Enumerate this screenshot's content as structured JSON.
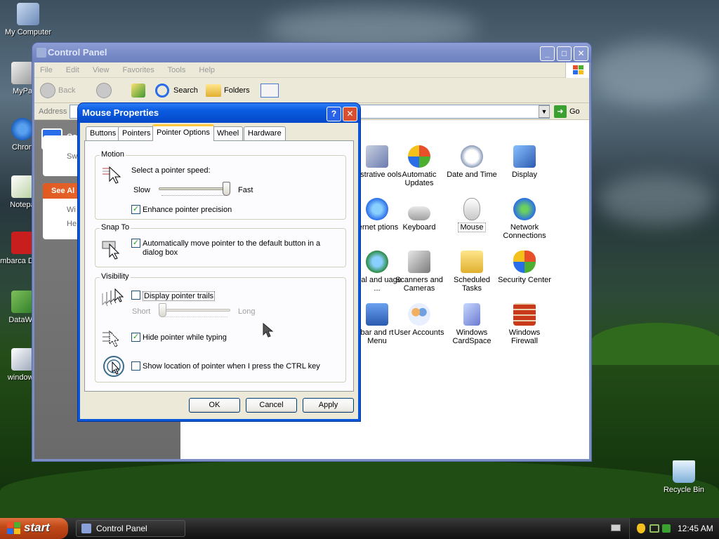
{
  "desktop": {
    "icons": [
      {
        "label": "My Computer"
      },
      {
        "label": "MyPa"
      },
      {
        "label": "Chron"
      },
      {
        "label": "Notepa"
      },
      {
        "label": "Embarca Dev-C"
      },
      {
        "label": "DataWa"
      },
      {
        "label": "windows"
      }
    ],
    "recycle_bin": "Recycle Bin"
  },
  "control_panel": {
    "title": "Control Panel",
    "menu": [
      "File",
      "Edit",
      "View",
      "Favorites",
      "Tools",
      "Help"
    ],
    "toolbar": {
      "back": "Back",
      "search": "Search",
      "folders": "Folders"
    },
    "address_label": "Address",
    "go_label": "Go",
    "left_pane": {
      "header1": "Cor",
      "switch_link": "Sw",
      "see_also": "See Al",
      "link_windows": "Wi",
      "link_help": "He"
    },
    "icons": [
      {
        "label": "inistrative ools"
      },
      {
        "label": "Automatic Updates"
      },
      {
        "label": "Date and Time"
      },
      {
        "label": "Display"
      },
      {
        "label": "ternet ptions"
      },
      {
        "label": "Keyboard"
      },
      {
        "label": "Mouse"
      },
      {
        "label": "Network Connections"
      },
      {
        "label": "onal and uage ..."
      },
      {
        "label": "Scanners and Cameras"
      },
      {
        "label": "Scheduled Tasks"
      },
      {
        "label": "Security Center"
      },
      {
        "label": "bar and rt Menu"
      },
      {
        "label": "User Accounts"
      },
      {
        "label": "Windows CardSpace"
      },
      {
        "label": "Windows Firewall"
      }
    ]
  },
  "mouse_properties": {
    "title": "Mouse Properties",
    "help_btn": "?",
    "close_btn": "✕",
    "tabs": [
      "Buttons",
      "Pointers",
      "Pointer Options",
      "Wheel",
      "Hardware"
    ],
    "active_tab": "Pointer Options",
    "motion": {
      "group_label": "Motion",
      "speed_label": "Select a pointer speed:",
      "slow": "Slow",
      "fast": "Fast",
      "speed_value": 1.0,
      "precision_label": "Enhance pointer precision",
      "precision_checked": true
    },
    "snap_to": {
      "group_label": "Snap To",
      "label": "Automatically move pointer to the default button in a dialog box",
      "checked": true
    },
    "visibility": {
      "group_label": "Visibility",
      "trails_label": "Display pointer trails",
      "trails_checked": false,
      "short": "Short",
      "long": "Long",
      "trails_value": 0.0,
      "hide_label": "Hide pointer while typing",
      "hide_checked": true,
      "ctrl_label": "Show location of pointer when I press the CTRL key",
      "ctrl_checked": false
    },
    "buttons": {
      "ok": "OK",
      "cancel": "Cancel",
      "apply": "Apply"
    }
  },
  "taskbar": {
    "start": "start",
    "task": "Control Panel",
    "clock": "12:45 AM"
  },
  "colors": {
    "xp_blue": "#0a58d8",
    "dialog_bg": "#ece9d8",
    "checkmark": "#21a121",
    "start_orange": "#c24a18"
  }
}
